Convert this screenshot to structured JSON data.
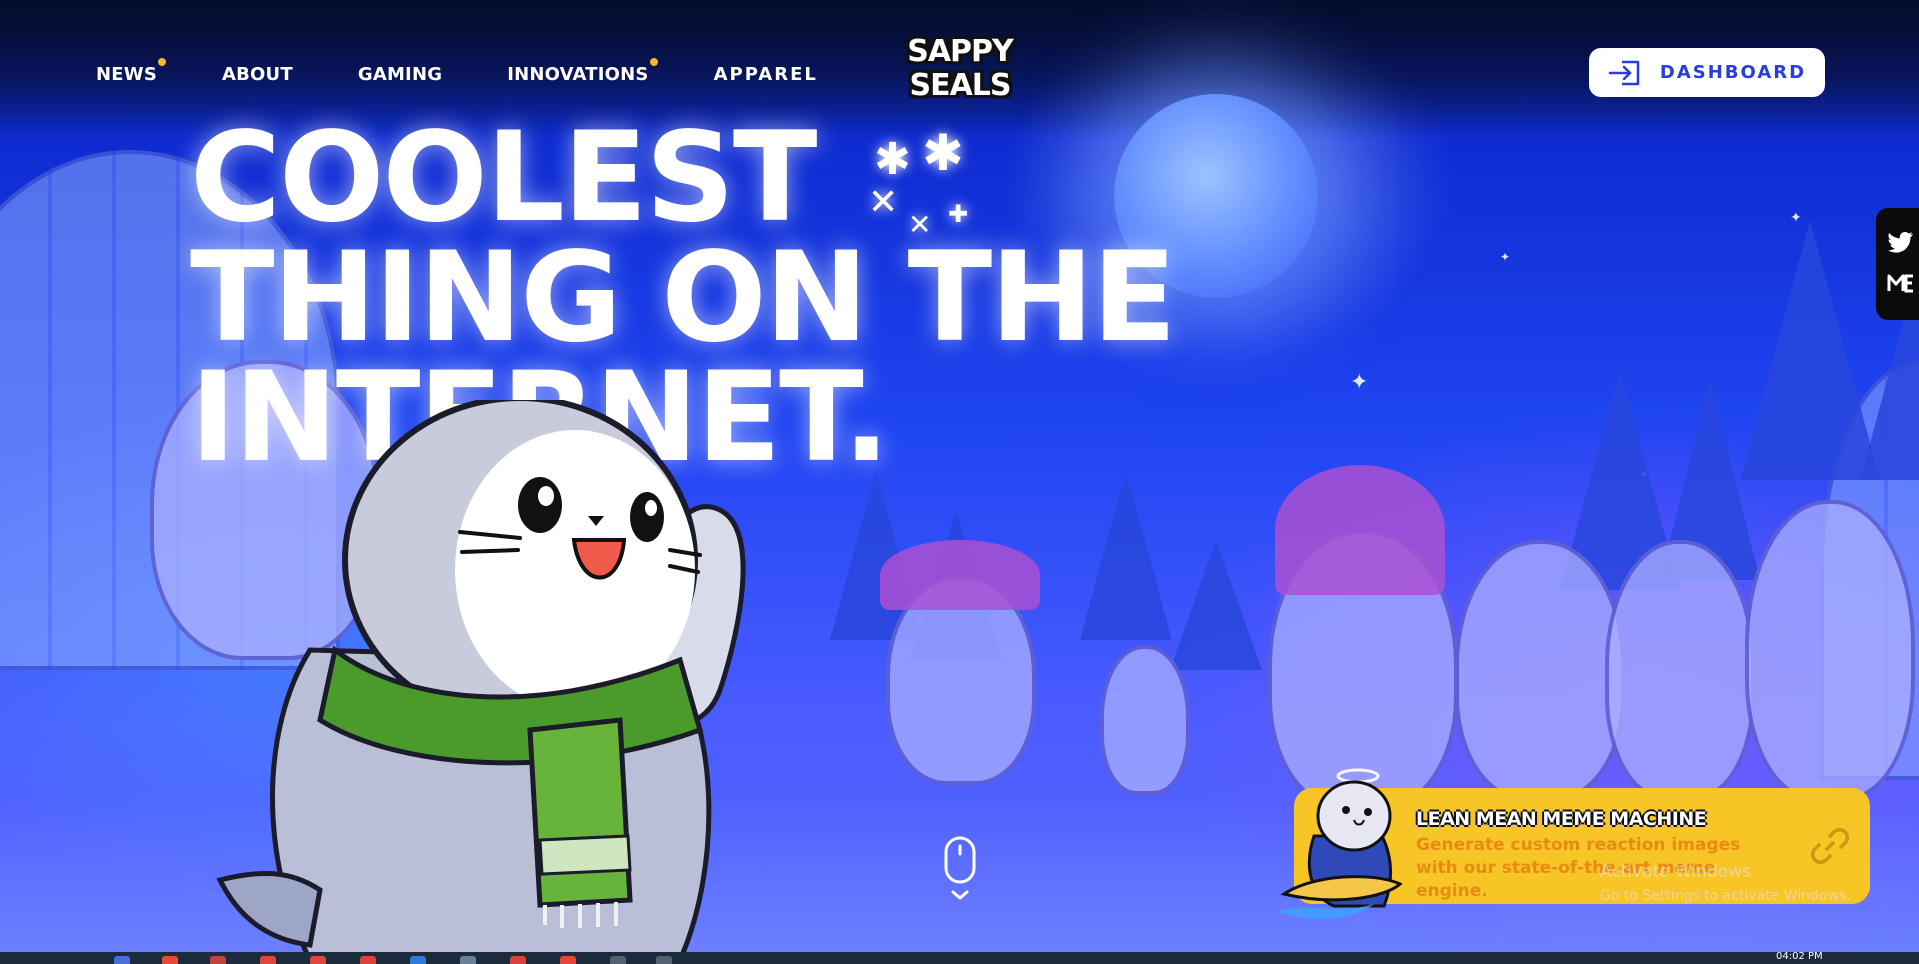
{
  "nav": {
    "items": [
      {
        "label": "NEWS",
        "has_dot": true
      },
      {
        "label": "ABOUT",
        "has_dot": false
      },
      {
        "label": "GAMING",
        "has_dot": false
      },
      {
        "label": "INNOVATIONS",
        "has_dot": true
      },
      {
        "label": "APPAREL",
        "has_dot": false
      }
    ],
    "dot_color": "#f6b52a"
  },
  "logo": {
    "line1": "SAPPY",
    "line2": "SEALS"
  },
  "dashboard_button": {
    "label": "DASHBOARD",
    "icon": "login-icon"
  },
  "hero": {
    "headline_line1": "COOLEST",
    "headline_line2": "THING ON THE",
    "headline_line3": "INTERNET."
  },
  "social": {
    "icons": [
      "twitter-icon",
      "magic-eden-icon"
    ],
    "twitter_glyph": "🐦",
    "me_glyph": "ME"
  },
  "meme_card": {
    "title": "LEAN MEAN MEME MACHINE",
    "description": "Generate custom reaction images with our state-of-the-art meme engine.",
    "icon": "link-icon",
    "background": "#f8c526"
  },
  "os_watermark": {
    "line1": "Activate Windows",
    "line2": "Go to Settings to activate Windows."
  },
  "taskbar": {
    "time": "04:02 PM"
  },
  "colors": {
    "accent_blue": "#2b3dd8",
    "sky_dark": "#07154a",
    "sky_mid": "#1f45f2",
    "yellow": "#f8c526"
  }
}
